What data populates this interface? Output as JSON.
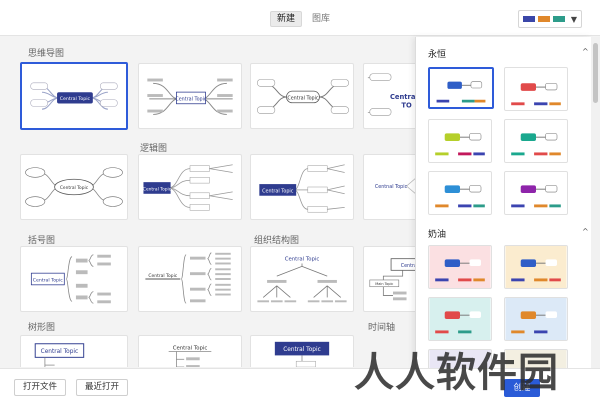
{
  "header": {
    "tabs": [
      {
        "label": "新建",
        "active": true
      },
      {
        "label": "图库",
        "active": false
      }
    ],
    "theme_swatches": [
      "#3a46a8",
      "#e0882b",
      "#2d9c8a"
    ]
  },
  "sections": {
    "mindmap": "思维导图",
    "logic": "逻辑图",
    "bracket": "括号图",
    "org": "组织结构图",
    "tree": "树形图",
    "timeline": "时间轴"
  },
  "cards": {
    "central_topic": "Central Topic",
    "central_topic_alt": "Centnal Topic",
    "central_topic_short": "Centra",
    "central_topic_trunc": "TO",
    "main_topic": "Main Topic",
    "sub_topic": "Sub Topic"
  },
  "panel": {
    "sections": [
      {
        "label": "永恒",
        "caret": "^"
      },
      {
        "label": "奶油",
        "caret": "^"
      }
    ]
  },
  "footer": {
    "open_file": "打开文件",
    "recent": "最近打开",
    "create": "创建"
  },
  "watermark": "人人软件园",
  "colors": {
    "accent": "#2e5bd9",
    "navy": "#2f3c8f"
  }
}
